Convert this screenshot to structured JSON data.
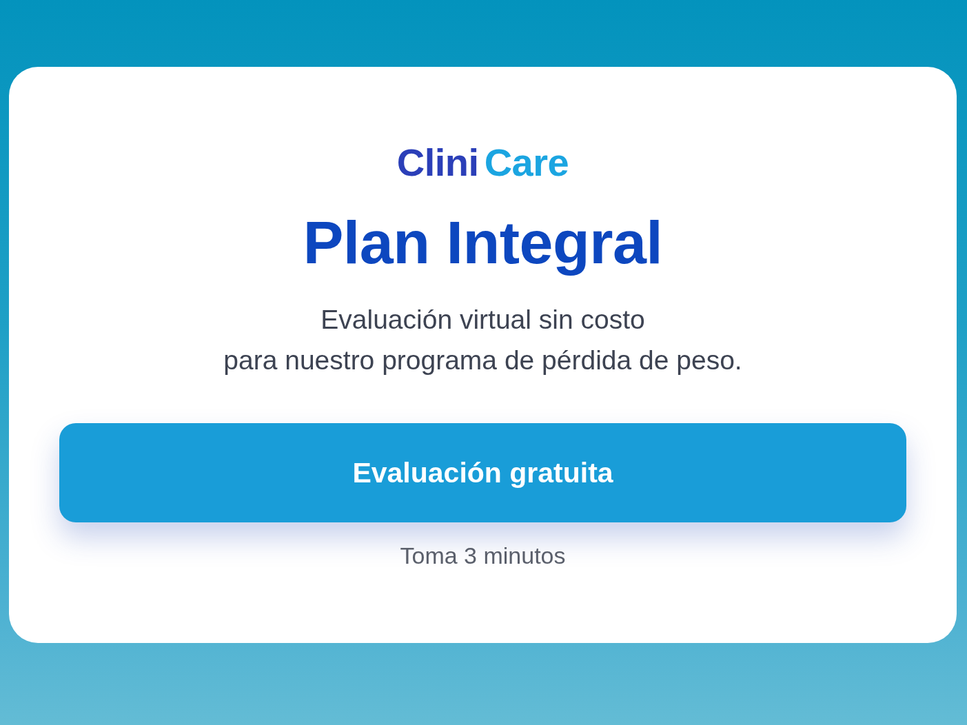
{
  "logo": {
    "words": [
      {
        "text": "Clini",
        "color": "#2b3fb8"
      },
      {
        "text": "Care",
        "color": "#1ba5e1"
      }
    ]
  },
  "title": "Plan Integral",
  "subtitle_lines": [
    "Evaluación virtual sin costo",
    "para nuestro programa de pérdida de peso."
  ],
  "cta_button": {
    "label": "Evaluación gratuita"
  },
  "note": "Toma 3 minutos"
}
